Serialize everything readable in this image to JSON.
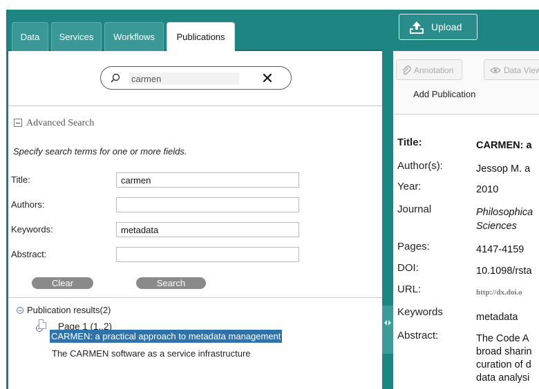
{
  "tabs": [
    {
      "label": "Data",
      "active": false
    },
    {
      "label": "Services",
      "active": false
    },
    {
      "label": "Workflows",
      "active": false
    },
    {
      "label": "Publications",
      "active": true
    }
  ],
  "search": {
    "value": "carmen",
    "clear_glyph": "✕"
  },
  "advanced": {
    "title": "Advanced Search",
    "hint": "Specify search terms for one or more fields.",
    "fields": [
      {
        "label": "Title:",
        "value": "carmen"
      },
      {
        "label": "Authors:",
        "value": ""
      },
      {
        "label": "Keywords:",
        "value": "metadata"
      },
      {
        "label": "Abstract:",
        "value": ""
      }
    ],
    "clear_label": "Clear",
    "search_label": "Search"
  },
  "results": {
    "root_label": "Publication results(2)",
    "page_label": "Page 1 (1..2)",
    "items": [
      {
        "title": "CARMEN: a practical approach to metadata management",
        "selected": true
      },
      {
        "title": "The CARMEN software as a service infrastructure",
        "selected": false
      }
    ]
  },
  "right": {
    "upload_label": "Upload",
    "annotation_label": "Annotation",
    "data_view_label": "Data View",
    "add_publication": "Add Publication",
    "details": [
      {
        "label": "Title:",
        "value": "CARMEN: a",
        "bold": true
      },
      {
        "label": "Author(s):",
        "value": "Jessop M. a"
      },
      {
        "label": "Year:",
        "value": "2010"
      },
      {
        "label": "Journal",
        "value": "Philosophica",
        "value2": "Sciences",
        "italic": true
      },
      {
        "label": "Pages:",
        "value": "4147-4159"
      },
      {
        "label": "DOI:",
        "value": "10.1098/rsta"
      },
      {
        "label": "URL:",
        "value": "http://dx.doi.o",
        "small": true
      },
      {
        "label": "Keywords",
        "value": "metadata"
      },
      {
        "label": "Abstract:",
        "value": "The Code A",
        "lines": [
          "broad sharin",
          "curation of d",
          "data analysi"
        ]
      }
    ]
  },
  "colors": {
    "teal": "#1f8583",
    "selection": "#2f73a8",
    "pill": "#8a8a8a"
  }
}
